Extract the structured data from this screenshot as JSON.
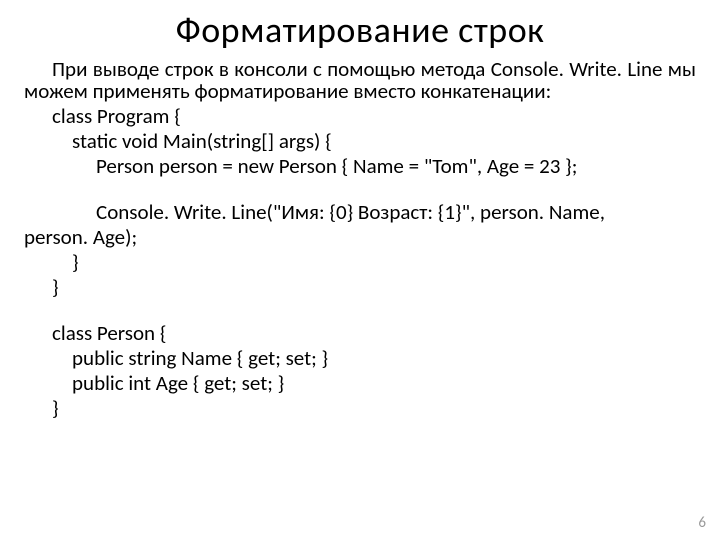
{
  "title": "Форматирование строк",
  "intro_text": "При выводе строк в консоли с помощью метода Console. Write. Line мы можем применять форматирование вместо конкатенации:",
  "code": {
    "l1": "class Program {",
    "l2": "static void Main(string[] args) {",
    "l3": "Person person = new Person { Name = \"Tom\", Age = 23 };",
    "l4a": "Console. Write. Line(\"Имя: {0}  Возраст: {1}\", person. Name,",
    "l4b": "person. Age);",
    "l5": "}",
    "l6": "}",
    "l7": "class Person {",
    "l8": "public string Name { get; set; }",
    "l9": "public int Age { get; set; }",
    "l10": "}"
  },
  "page_number": "6"
}
